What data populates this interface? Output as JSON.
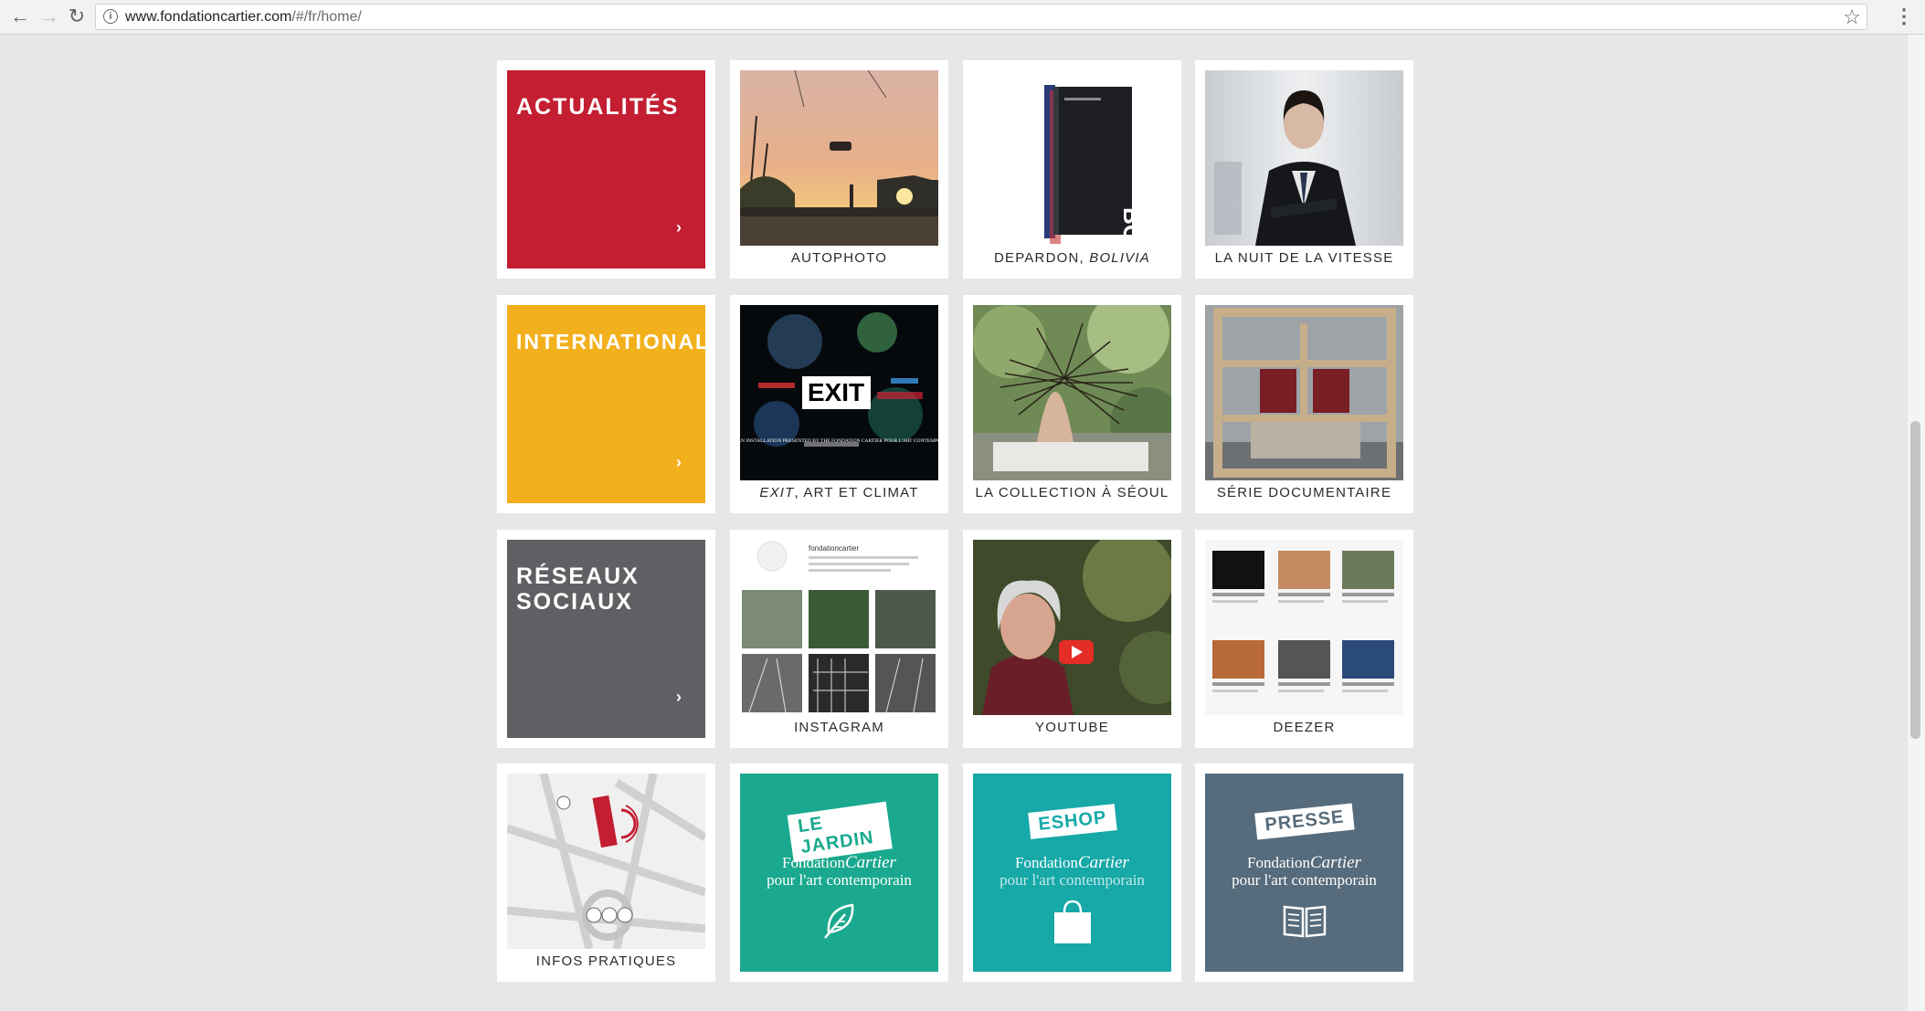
{
  "browser": {
    "url_domain": "www.fondationcartier.com",
    "url_path": "/#/fr/home/",
    "icons": [
      "back-arrow-icon",
      "forward-arrow-icon",
      "reload-icon",
      "info-icon",
      "star-icon",
      "menu-icon"
    ]
  },
  "tiles": {
    "actualites": {
      "title": "ACTUALITÉS",
      "color": "#c41e32"
    },
    "autophoto": {
      "caption": "AUTOPHOTO"
    },
    "depardon": {
      "caption_a": "DEPARDON, ",
      "caption_b": "BOLIVIA",
      "book_spine": "BOLIVIA"
    },
    "nuit": {
      "caption": "LA NUIT DE LA VITESSE"
    },
    "international": {
      "title": "INTERNATIONAL",
      "color": "#f3b01d"
    },
    "exit": {
      "caption_a": "EXIT",
      "caption_b": ", ART ET CLIMAT",
      "label": "EXIT",
      "sub": "EXIT, AN INSTALLATION PRESENTED BY THE FONDATION CARTIER POUR L'ART CONTEMPORAIN"
    },
    "seoul": {
      "caption": "LA COLLECTION À SÉOUL"
    },
    "serie": {
      "caption": "SÉRIE DOCUMENTAIRE"
    },
    "reseaux": {
      "title_1": "RÉSEAUX",
      "title_2": "SOCIAUX",
      "color": "#5f6063"
    },
    "instagram": {
      "caption": "INSTAGRAM",
      "handle": "fondationcartier"
    },
    "youtube": {
      "caption": "YOUTUBE"
    },
    "deezer": {
      "caption": "DEEZER"
    },
    "infos": {
      "caption": "INFOS PRATIQUES"
    },
    "jardin": {
      "stamp": "LE JARDIN",
      "brand_1": "Fondation",
      "brand_2": "Cartier",
      "brand_3": "pour l'art contemporain",
      "color": "#1aa98e"
    },
    "eshop": {
      "stamp": "ESHOP",
      "brand_1": "Fondation",
      "brand_2": "Cartier",
      "brand_3": "pour l'art contemporain",
      "color": "#17a8a8"
    },
    "presse": {
      "stamp": "PRESSE",
      "brand_1": "Fondation",
      "brand_2": "Cartier",
      "brand_3": "pour l'art contemporain",
      "color": "#566b7b"
    }
  }
}
